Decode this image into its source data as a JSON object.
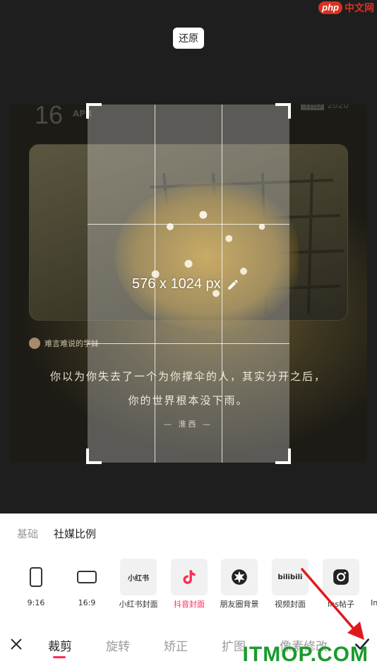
{
  "watermark_top": {
    "logo": "php",
    "text": "中文网"
  },
  "watermark_bottom": "ITMOP.COM",
  "reset_label": "还原",
  "photo": {
    "date_day": "16",
    "date_month": "APR",
    "year_badge": "THU",
    "year": "2020",
    "author": "难言难说的学妹",
    "quote_line1": "你以为你失去了一个为你撑伞的人，其实分开之后，",
    "quote_line2": "你的世界根本没下雨。",
    "signature": "— 淮西 —"
  },
  "crop": {
    "dimension": "576 x 1024 px"
  },
  "mode_tabs": {
    "basic": "基础",
    "social": "社媒比例"
  },
  "presets": [
    {
      "label": "9:16",
      "icon": "portrait-ratio-icon"
    },
    {
      "label": "16:9",
      "icon": "landscape-ratio-icon"
    },
    {
      "label": "小红书封面",
      "icon": "xiaohongshu-icon",
      "tile_text": "小红书"
    },
    {
      "label": "抖音封面",
      "icon": "douyin-icon",
      "selected": true
    },
    {
      "label": "朋友圈背景",
      "icon": "moments-icon"
    },
    {
      "label": "视频封面",
      "icon": "bilibili-icon",
      "tile_text": "bilibili"
    },
    {
      "label": "Ins帖子",
      "icon": "instagram-icon"
    },
    {
      "label": "In",
      "icon": "instagram-icon"
    }
  ],
  "bottom_tabs": [
    "裁剪",
    "旋转",
    "矫正",
    "扩图",
    "像素修改"
  ],
  "active_tab": "裁剪",
  "colors": {
    "accent": "#fe2c55",
    "watermark": "#1b9a2c",
    "php_red": "#d9301f"
  }
}
